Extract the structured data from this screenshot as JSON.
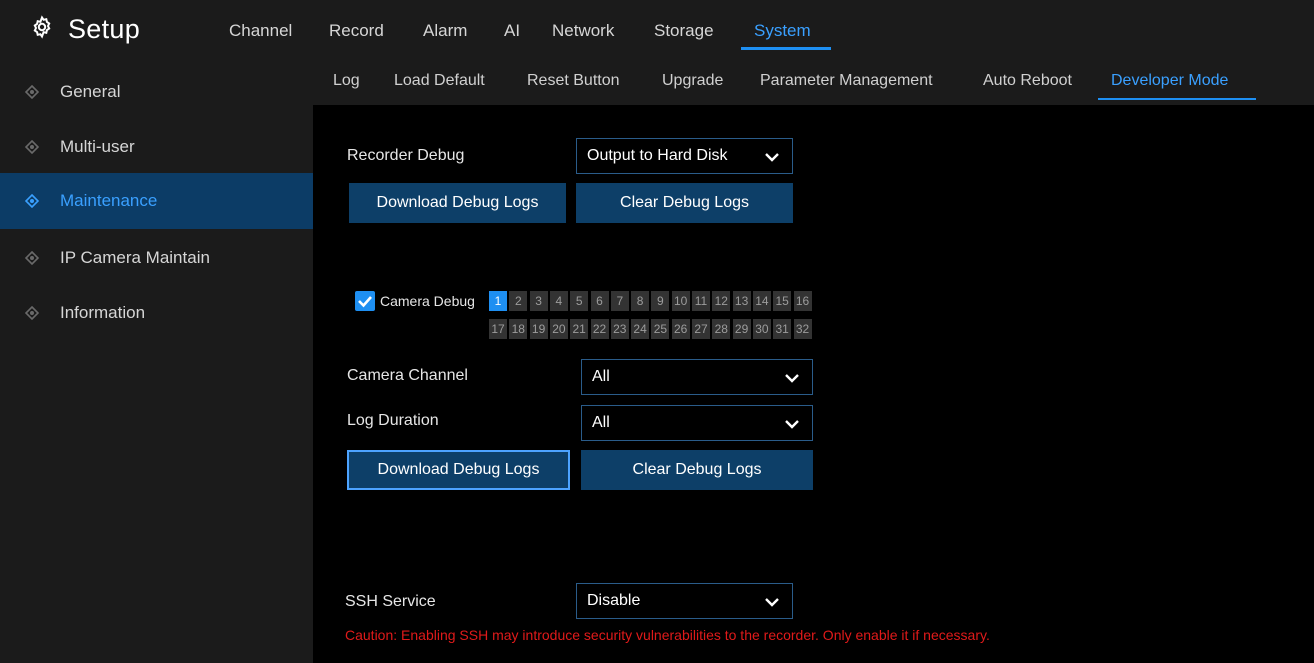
{
  "app": {
    "title": "Setup",
    "icon": "gear-icon"
  },
  "top_nav": [
    {
      "label": "Channel"
    },
    {
      "label": "Record"
    },
    {
      "label": "Alarm"
    },
    {
      "label": "AI"
    },
    {
      "label": "Network"
    },
    {
      "label": "Storage"
    },
    {
      "label": "System",
      "active": true
    }
  ],
  "sidebar": {
    "items": [
      {
        "label": "General"
      },
      {
        "label": "Multi-user"
      },
      {
        "label": "Maintenance",
        "active": true
      },
      {
        "label": "IP Camera Maintain"
      },
      {
        "label": "Information"
      }
    ]
  },
  "sub_tabs": [
    {
      "label": "Log"
    },
    {
      "label": "Load Default"
    },
    {
      "label": "Reset Button"
    },
    {
      "label": "Upgrade"
    },
    {
      "label": "Parameter Management"
    },
    {
      "label": "Auto Reboot"
    },
    {
      "label": "Developer Mode",
      "active": true
    }
  ],
  "recorder_debug": {
    "label": "Recorder Debug",
    "value": "Output to Hard Disk",
    "download_label": "Download Debug Logs",
    "clear_label": "Clear Debug Logs"
  },
  "camera_debug": {
    "label": "Camera Debug",
    "checked": true,
    "channels": [
      "1",
      "2",
      "3",
      "4",
      "5",
      "6",
      "7",
      "8",
      "9",
      "10",
      "11",
      "12",
      "13",
      "14",
      "15",
      "16",
      "17",
      "18",
      "19",
      "20",
      "21",
      "22",
      "23",
      "24",
      "25",
      "26",
      "27",
      "28",
      "29",
      "30",
      "31",
      "32"
    ],
    "selected_channel": "1"
  },
  "camera_channel": {
    "label": "Camera Channel",
    "value": "All"
  },
  "log_duration": {
    "label": "Log Duration",
    "value": "All"
  },
  "camera_logs": {
    "download_label": "Download Debug Logs",
    "clear_label": "Clear Debug Logs"
  },
  "ssh": {
    "label": "SSH Service",
    "value": "Disable",
    "caution": "Caution: Enabling SSH may introduce security vulnerabilities to the recorder. Only enable it if necessary."
  },
  "colors": {
    "accent": "#1e8ff2",
    "active_text": "#3aa0ff",
    "button_bg": "#0d3f68",
    "sidebar_active_bg": "#0c3c66",
    "caution": "#e01a1a"
  }
}
